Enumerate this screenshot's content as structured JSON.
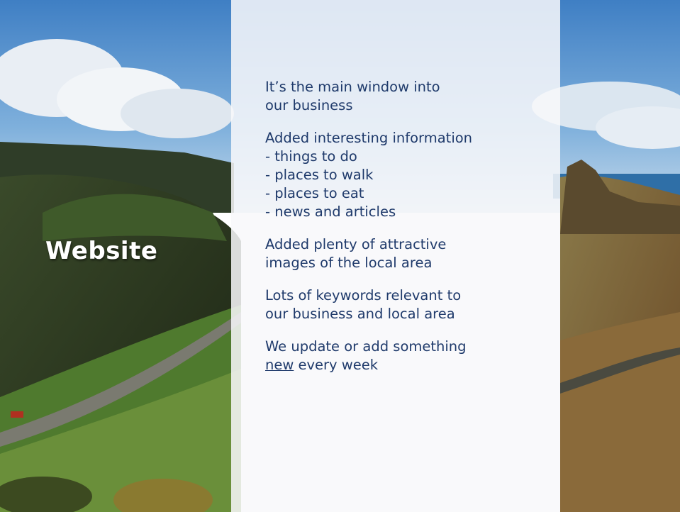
{
  "slide": {
    "title": "Website",
    "paragraphs": [
      {
        "lines": [
          "It’s the main window into",
          "our business"
        ]
      },
      {
        "lines": [
          "Added interesting information",
          "- things to do",
          "- places to walk",
          "- places to eat",
          "- news and articles"
        ]
      },
      {
        "lines": [
          "Added plenty of attractive",
          "images of the local area"
        ]
      },
      {
        "lines": [
          "Lots of keywords relevant to",
          "our business and local area"
        ]
      },
      {
        "underlined_word": "new",
        "line1": "We update or add something",
        "line2_rest": " every week"
      }
    ]
  },
  "colors": {
    "text": "#1f3a6b",
    "title": "#ffffff",
    "panel": "#f8f8fa"
  },
  "background_image": "coastal valley landscape with hills, road and sea under blue sky"
}
